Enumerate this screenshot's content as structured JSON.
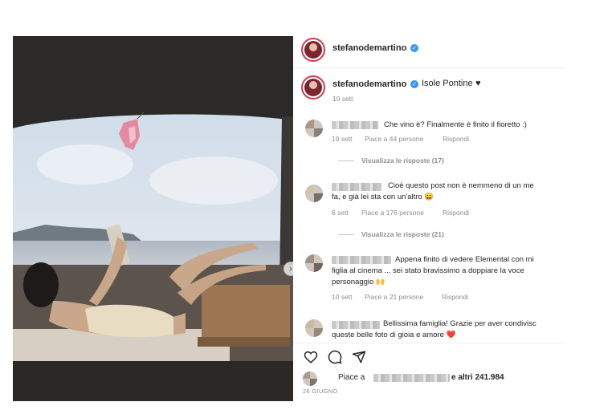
{
  "header": {
    "username": "stefanodemartino"
  },
  "caption": {
    "username": "stefanodemartino",
    "text": "Isole Pontine",
    "time": "10 sett"
  },
  "comments": [
    {
      "text": "Che vino è? Finalmente è finito il fioretto :)",
      "time": "10 sett",
      "likes": "Piace a 44 persone",
      "reply": "Rispondi",
      "view_replies": "Visualizza le risposte (17)"
    },
    {
      "text_line1": "Cioè questo post non è nemmeno di un me",
      "text_line2": "fa, e già lei sta con un'altro 😄",
      "time": "6 sett",
      "likes": "Piace a 176 persone",
      "reply": "Rispondi",
      "view_replies": "Visualizza le risposte (21)"
    },
    {
      "text_line1": "Appena finito di vedere Elemental con mi",
      "text_line2": "figlia al cinema ... sei stato bravissimo a doppiare la voce",
      "text_line3": "personaggio 🙌",
      "time": "10 sett",
      "likes": "Piace a 21 persone",
      "reply": "Rispondi"
    },
    {
      "text_line1": "Bellissima famiglia! Grazie per aver condivisc",
      "text_line2": "queste belle foto di gioia e amore ❤️"
    }
  ],
  "likes": {
    "prefix": "Piace a",
    "suffix": "e altri 241.984"
  },
  "post_date": "26 GIUGNO",
  "icons": {
    "verified": "verified-badge-icon",
    "heart": "heart-icon",
    "comment": "comment-icon",
    "share": "share-icon",
    "bookmark": "bookmark-icon",
    "carousel_next": "chevron-right-icon"
  },
  "colors": {
    "verified": "#3897f0",
    "avatar_ring": "#d23b53",
    "text_secondary": "#8e8e8e"
  }
}
